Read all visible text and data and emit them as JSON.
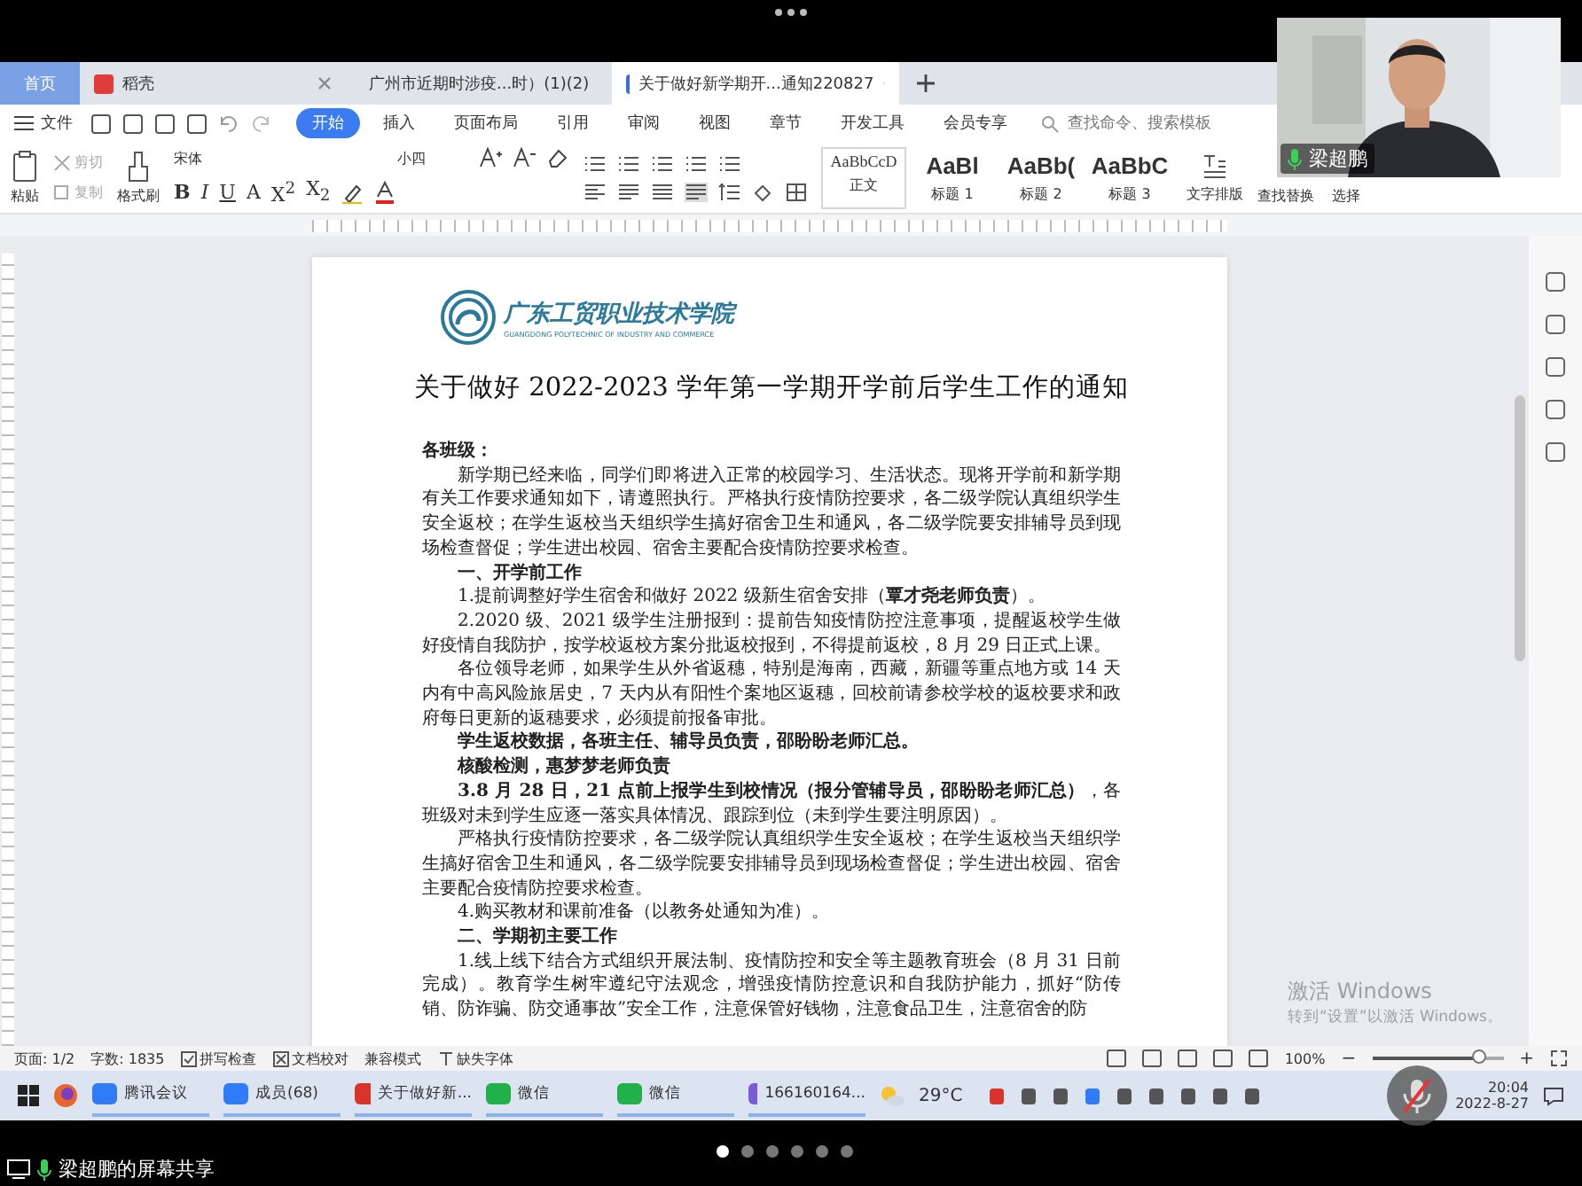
{
  "tabs": [
    {
      "label": "首页",
      "kind": "home",
      "selected": false
    },
    {
      "label": "稻壳",
      "kind": "docer",
      "selected": false
    },
    {
      "label": "广州市近期时涉疫...时）(1)(2)",
      "kind": "sheet",
      "selected": false
    },
    {
      "label": "关于做好新学期开...通知220827",
      "kind": "doc",
      "selected": true
    }
  ],
  "menu": {
    "file": "文件",
    "items": [
      {
        "label": "开始",
        "selected": true
      },
      {
        "label": "插入",
        "selected": false
      },
      {
        "label": "页面布局",
        "selected": false
      },
      {
        "label": "引用",
        "selected": false
      },
      {
        "label": "审阅",
        "selected": false
      },
      {
        "label": "视图",
        "selected": false
      },
      {
        "label": "章节",
        "selected": false
      },
      {
        "label": "开发工具",
        "selected": false
      },
      {
        "label": "会员专享",
        "selected": false
      }
    ],
    "search": {
      "placeholder": "查找命令、搜索模板"
    }
  },
  "ribbon": {
    "paste": "粘贴",
    "cut": "剪切",
    "copy": "复制",
    "format_painter": "格式刷",
    "font": "宋体",
    "size": "小四",
    "format_buttons": [
      "B",
      "I",
      "U",
      "A",
      "X$^{2}$",
      "X$_{2}$"
    ],
    "styles": [
      {
        "preview": "AaBbCcD",
        "label": "正文",
        "selected": true
      },
      {
        "preview": "AaBl",
        "label": "标题 1",
        "selected": false
      },
      {
        "preview": "AaBb(",
        "label": "标题 2",
        "selected": false
      },
      {
        "preview": "AaBbC",
        "label": "标题 3",
        "selected": false
      }
    ],
    "typesetting": "文字排版",
    "find_replace": "查找替换",
    "select": "选择"
  },
  "video": {
    "kind": "picture",
    "name": "梁超鹏"
  },
  "document": {
    "logo_name": "广东工贸职业技术学院",
    "logo_subtitle": "GUANGDONG POLYTECHNIC OF INDUSTRY AND COMMERCE",
    "title": "关于做好 2022-2023 学年第一学期开学前后学生工作的通知",
    "paragraphs": [
      {
        "kind": "bold",
        "indent": false,
        "text": "各班级："
      },
      {
        "kind": "body",
        "indent": true,
        "text": "新学期已经来临，同学们即将进入正常的校园学习、生活状态。现将开学前和新学期有关工作要求通知如下，请遵照执行。严格执行疫情防控要求，各二级学院认真组织学生安全返校；在学生返校当天组织学生搞好宿舍卫生和通风，各二级学院要安排辅导员到现场检查督促；学生进出校园、宿舍主要配合疫情防控要求检查。"
      },
      {
        "kind": "bold",
        "indent": true,
        "text": "一、开学前工作"
      },
      {
        "kind": "body",
        "indent": true,
        "text": "1.提前调整好学生宿舍和做好 2022 级新生宿舍安排（**覃才尧老师负责**）。"
      },
      {
        "kind": "body",
        "indent": true,
        "text": "2.2020 级、2021 级学生注册报到：提前告知疫情防控注意事项，提醒返校学生做好疫情自我防护，按学校返校方案分批返校报到，不得提前返校，8 月 29 日正式上课。"
      },
      {
        "kind": "body",
        "indent": true,
        "text": "各位领导老师，如果学生从外省返穗，特别是海南，西藏，新疆等重点地方或 14 天内有中高风险旅居史，7 天内从有阳性个案地区返穗，回校前请参校学校的返校要求和政府每日更新的返穗要求，必须提前报备审批。"
      },
      {
        "kind": "bold",
        "indent": true,
        "text": "学生返校数据，各班主任、辅导员负责，邵盼盼老师汇总。"
      },
      {
        "kind": "bold",
        "indent": true,
        "text": "核酸检测，惠梦梦老师负责"
      },
      {
        "kind": "body",
        "indent": true,
        "text": "**3.8 月 28 日，21 点前上报学生到校情况（报分管辅导员，邵盼盼老师汇总）**，各班级对未到学生应逐一落实具体情况、跟踪到位（未到学生要注明原因）。"
      },
      {
        "kind": "body",
        "indent": true,
        "text": "严格执行疫情防控要求，各二级学院认真组织学生安全返校；在学生返校当天组织学生搞好宿舍卫生和通风，各二级学院要安排辅导员到现场检查督促；学生进出校园、宿舍主要配合疫情防控要求检查。"
      },
      {
        "kind": "body",
        "indent": true,
        "text": "4.购买教材和课前准备（以教务处通知为准）。"
      },
      {
        "kind": "bold",
        "indent": true,
        "text": "二、学期初主要工作"
      },
      {
        "kind": "body",
        "indent": true,
        "text": "1.线上线下结合方式组织开展法制、疫情防控和安全等主题教育班会（8 月 31 日前完成）。教育学生树牢遵纪守法观念，增强疫情防控意识和自我防护能力，抓好“防传销、防诈骗、防交通事故”安全工作，注意保管好钱物，注意食品卫生，注意宿舍的防"
      }
    ]
  },
  "activation": {
    "title": "激活 Windows",
    "hint": "转到“设置”以激活 Windows。"
  },
  "status_bar": {
    "page": "页面: 1/2",
    "words": "字数: 1835",
    "spell": "拼写检查",
    "proof": "文档校对",
    "compat": "兼容模式",
    "fonts": "缺失字体",
    "zoom": "100%",
    "zoom_out": "−",
    "zoom_in": "+",
    "level": 0.82
  },
  "taskbar": {
    "apps": [
      {
        "label": "腾讯会议",
        "kind": "meeting"
      },
      {
        "label": "成员(68)",
        "kind": "meeting"
      },
      {
        "label": "关于做好新...",
        "kind": "wps"
      },
      {
        "label": "微信",
        "kind": "wechat"
      },
      {
        "label": "微信",
        "kind": "wechat"
      },
      {
        "label": "166160164..."
      }
    ],
    "temperature": "29°C",
    "time": "20:04",
    "date": "2022-8-27",
    "mic_muted": true
  },
  "share": {
    "label": "梁超鹏的屏幕共享",
    "pages": [
      {
        "selected": true
      },
      {
        "selected": false
      },
      {
        "selected": false
      },
      {
        "selected": false
      },
      {
        "selected": false
      },
      {
        "selected": false
      }
    ]
  }
}
